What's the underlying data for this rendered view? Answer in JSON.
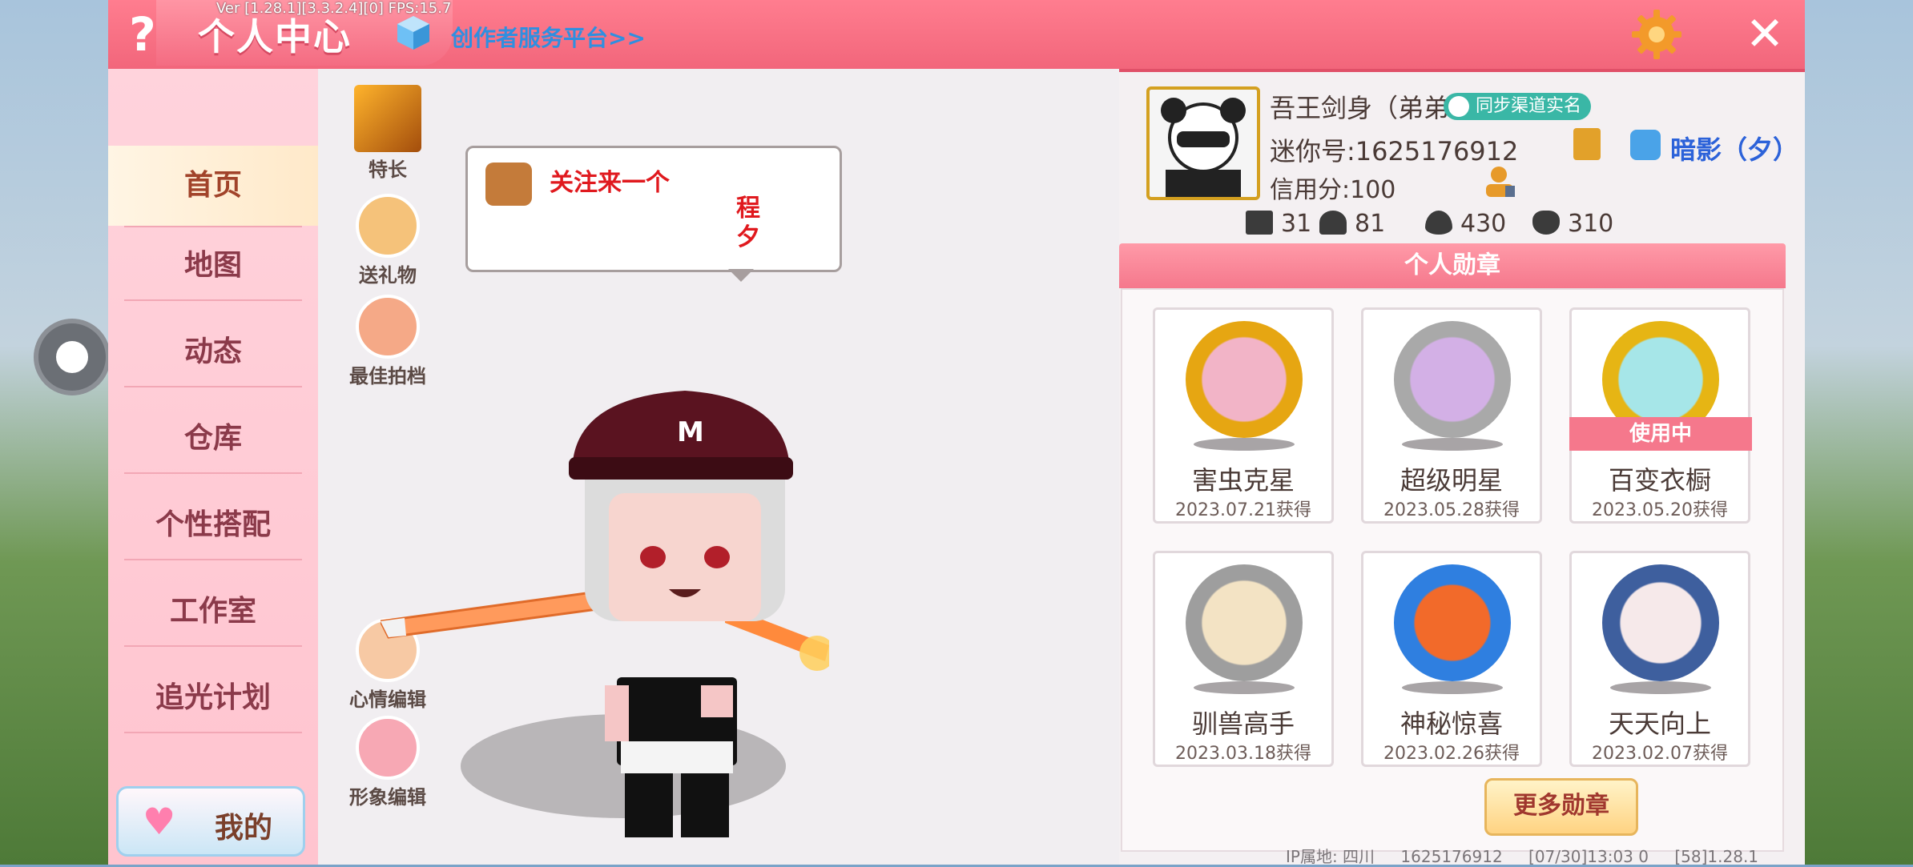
{
  "debug_overlay": "Ver [1.28.1][3.3.2.4][0] FPS:15.7",
  "topbar": {
    "help_label": "?",
    "title": "个人中心",
    "creator_link": "创作者服务平台>>",
    "close_label": "✕"
  },
  "sidebar": {
    "items": [
      {
        "label": "首页",
        "active": true
      },
      {
        "label": "地图",
        "active": false
      },
      {
        "label": "动态",
        "active": false
      },
      {
        "label": "仓库",
        "active": false
      },
      {
        "label": "个性搭配",
        "active": false
      },
      {
        "label": "工作室",
        "active": false
      },
      {
        "label": "追光计划",
        "active": false
      }
    ],
    "mine_label": "我的"
  },
  "scene": {
    "buttons": {
      "talent": "特长",
      "gift": "送礼物",
      "partner": "最佳拍档",
      "mood_edit": "心情编辑",
      "avatar_edit": "形象编辑"
    },
    "bubble": {
      "line1": "关注来一个",
      "line2": "程\n夕"
    },
    "hat_letter": "M"
  },
  "profile": {
    "nickname": "吾王剑身（弟弟",
    "sync_badge": "同步渠道实名",
    "mini_id": "迷你号:1625176912",
    "clan": "暗影（夕）",
    "credit": "信用分:100",
    "stats": {
      "plus": "31",
      "fans": "81",
      "fire": "430",
      "likes": "310"
    }
  },
  "medals": {
    "header": "个人勋章",
    "items": [
      {
        "name": "害虫克星",
        "date": "2023.07.21获得",
        "in_use": ""
      },
      {
        "name": "超级明星",
        "date": "2023.05.28获得",
        "in_use": ""
      },
      {
        "name": "百变衣橱",
        "date": "2023.05.20获得",
        "in_use": "使用中"
      },
      {
        "name": "驯兽高手",
        "date": "2023.03.18获得",
        "in_use": ""
      },
      {
        "name": "神秘惊喜",
        "date": "2023.02.26获得",
        "in_use": ""
      },
      {
        "name": "天天向上",
        "date": "2023.02.07获得",
        "in_use": ""
      }
    ],
    "more_button": "更多勋章"
  },
  "footer": {
    "ip": "IP属地: 四川",
    "uid": "1625176912",
    "time": "[07/30]13:03 0",
    "version": "[58]1.28.1"
  },
  "colors": {
    "topbar": "#f2667b",
    "sidebar": "#ffc4cf",
    "accent_text": "#e0191e",
    "clan_text": "#2c62d9",
    "medal_header": "#f5788c"
  }
}
